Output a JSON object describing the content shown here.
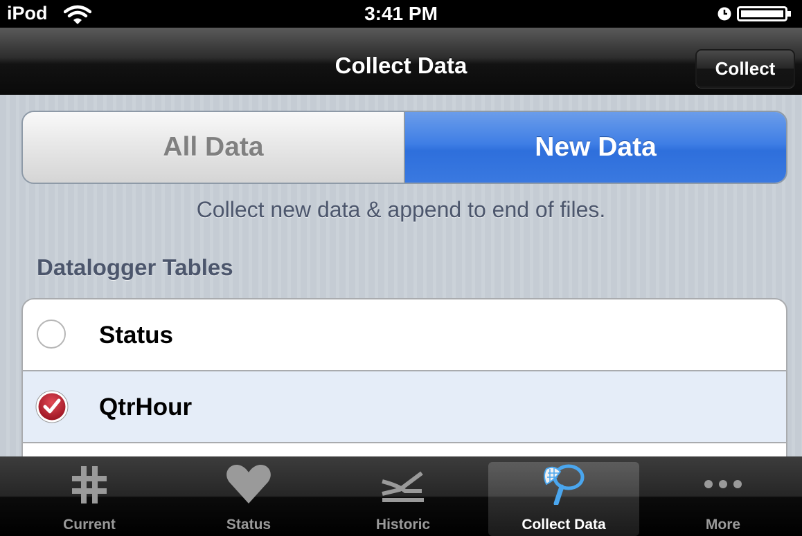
{
  "status_bar": {
    "carrier": "iPod",
    "time": "3:41 PM",
    "icons": [
      "wifi-icon",
      "clock-icon",
      "battery-icon"
    ]
  },
  "nav": {
    "title": "Collect Data",
    "collect_label": "Collect"
  },
  "segmented": {
    "options": [
      "All Data",
      "New Data"
    ],
    "selected": "New Data"
  },
  "hint": "Collect new data & append to end of files.",
  "tables": {
    "header": "Datalogger Tables",
    "items": [
      {
        "label": "Status",
        "checked": false
      },
      {
        "label": "QtrHour",
        "checked": true
      }
    ]
  },
  "tab_bar": {
    "active": "Collect Data",
    "tabs": [
      {
        "label": "Current",
        "icon": "grid-hash-icon"
      },
      {
        "label": "Status",
        "icon": "heart-icon"
      },
      {
        "label": "Historic",
        "icon": "historic-graph-icon"
      },
      {
        "label": "Collect Data",
        "icon": "collect-net-icon"
      },
      {
        "label": "More",
        "icon": "more-dots-icon"
      }
    ]
  },
  "colors": {
    "accent_blue": "#3f7ee5",
    "check_red": "#b31b2b",
    "background": "#c5ccd4"
  }
}
